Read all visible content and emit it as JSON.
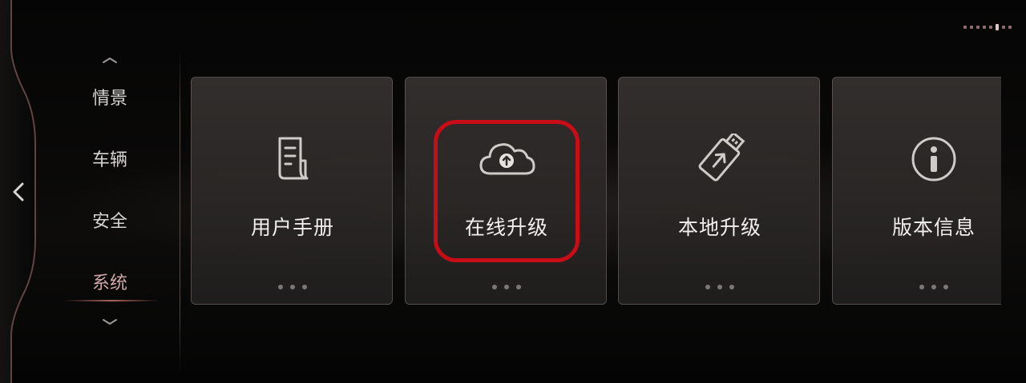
{
  "nav": {
    "items": [
      {
        "label": "情景",
        "active": false
      },
      {
        "label": "车辆",
        "active": false
      },
      {
        "label": "安全",
        "active": false
      },
      {
        "label": "系统",
        "active": true
      }
    ]
  },
  "cards": [
    {
      "label": "用户手册",
      "icon": "document-icon"
    },
    {
      "label": "在线升级",
      "icon": "cloud-upload-icon",
      "highlighted": true
    },
    {
      "label": "本地升级",
      "icon": "usb-upload-icon"
    },
    {
      "label": "版本信息",
      "icon": "info-icon"
    }
  ],
  "page_indicator": {
    "count": 8,
    "active_index": 5
  },
  "colors": {
    "highlight": "#c80d16",
    "active_nav": "#cfa9a7",
    "accent_line": "#ba6e64"
  }
}
